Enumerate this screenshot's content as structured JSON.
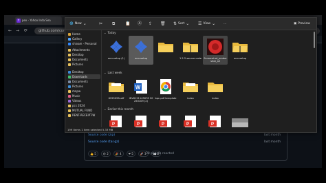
{
  "browser": {
    "tab_title": "pex - Yahoo Inda Sea",
    "tab_icon": "Y",
    "url": "github.com/com",
    "nav_back": "←",
    "nav_forward": "→",
    "nav_reload": "⟳"
  },
  "release": {
    "assets": [
      {
        "label": "Source code (zip)",
        "date": "last month"
      },
      {
        "label": "Source code (tar.gz)",
        "date": "last month"
      }
    ],
    "reactions": [
      "👍 5",
      "😄 2",
      "🎉 4",
      "❤ 5",
      "🚀 3",
      "👀 2"
    ],
    "reacted_text": "38 people reacted"
  },
  "explorer": {
    "toolbar": {
      "new": "New",
      "sort": "Sort",
      "view": "View",
      "more": "...",
      "preview": "Preview"
    },
    "nav": [
      {
        "label": "Home",
        "icon": "home-icon",
        "color": "#d7a33a"
      },
      {
        "label": "Gallery",
        "icon": "gallery-icon",
        "color": "#4ea3ff"
      },
      {
        "label": "shivam - Personal",
        "icon": "cloud-icon",
        "color": "#2f88ff"
      },
      {
        "label": "Attachments",
        "icon": "folder-icon",
        "color": "#e8c15b"
      },
      {
        "label": "Desktop",
        "icon": "folder-icon",
        "color": "#e8c15b"
      },
      {
        "label": "Documents",
        "icon": "folder-icon",
        "color": "#e8c15b"
      },
      {
        "label": "Pictures",
        "icon": "folder-icon",
        "color": "#e8c15b"
      },
      {
        "label": "Desktop",
        "icon": "desktop-icon",
        "color": "#3d8bd9"
      },
      {
        "label": "Downloads",
        "icon": "download-icon",
        "color": "#3ec26c",
        "selected": true
      },
      {
        "label": "Documents",
        "icon": "documents-icon",
        "color": "#7a8ba3"
      },
      {
        "label": "Pictures",
        "icon": "pictures-icon",
        "color": "#3e8fd9"
      },
      {
        "label": "mnpw",
        "icon": "folder-icon",
        "color": "#e8c15b"
      },
      {
        "label": "Music",
        "icon": "music-icon",
        "color": "#e35d8a"
      },
      {
        "label": "Videos",
        "icon": "videos-icon",
        "color": "#9c6ad9"
      },
      {
        "label": "pcs 2024",
        "icon": "folder-icon",
        "color": "#e8c15b"
      },
      {
        "label": "MUTUAL FUND",
        "icon": "folder-icon",
        "color": "#e8c15b"
      },
      {
        "label": "RENT-RECEIPT-W",
        "icon": "folder-icon",
        "color": "#e8c15b"
      }
    ],
    "groups": [
      {
        "header": "Today",
        "files": [
          {
            "name": "mm-setup (1)",
            "type": "app"
          },
          {
            "name": "mm-setup",
            "type": "app",
            "state": "selected"
          },
          {
            "name": "",
            "type": "folder"
          },
          {
            "name": "1.2.2 source code",
            "type": "zip"
          },
          {
            "name": "Screenshot_ember shot_all",
            "type": "red",
            "state": "selected2"
          },
          {
            "name": "mm-setup",
            "type": "zip-open"
          }
        ]
      },
      {
        "header": "Last week",
        "files": [
          {
            "name": "6225055caff",
            "type": "folder-doc"
          },
          {
            "name": "INV6121145678 20250109 (2)",
            "type": "word"
          },
          {
            "name": "bpc-pdf template",
            "type": "chrome"
          },
          {
            "name": "index",
            "type": "folder-doc"
          },
          {
            "name": "index",
            "type": "folder"
          }
        ]
      },
      {
        "header": "Earlier this month",
        "files": [
          {
            "name": "",
            "type": "pdf"
          },
          {
            "name": "",
            "type": "pdf"
          },
          {
            "name": "",
            "type": "pdf"
          },
          {
            "name": "",
            "type": "pdf"
          },
          {
            "name": "",
            "type": "pdf"
          },
          {
            "name": "",
            "type": "photo"
          }
        ]
      }
    ],
    "status": "199 items   1 item selected  5.33 MB"
  }
}
